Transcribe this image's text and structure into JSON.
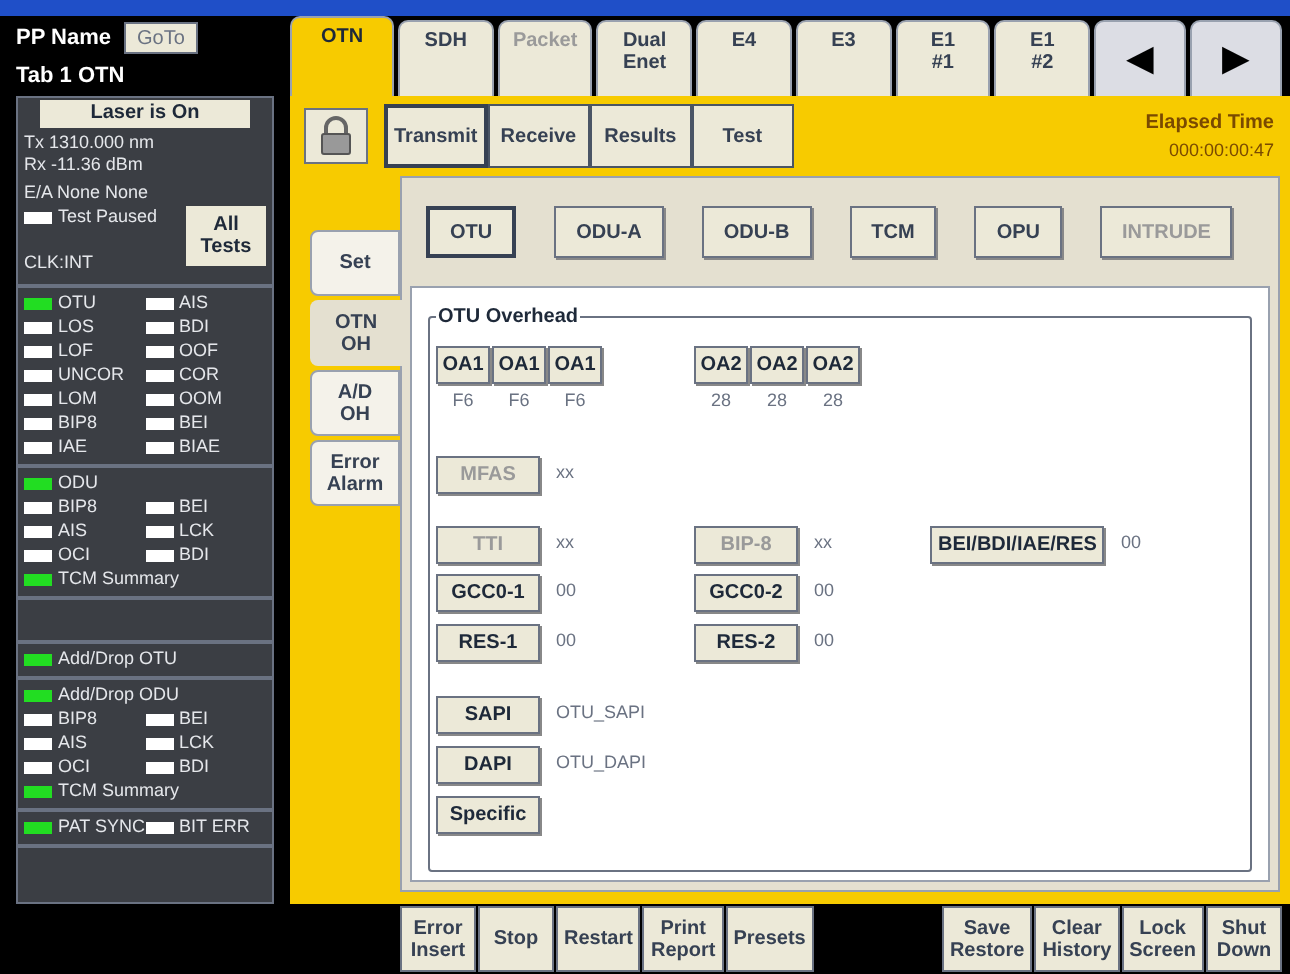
{
  "header": {
    "pp_name": "PP Name",
    "goto_button": "GoTo",
    "tab_label": "Tab 1 OTN"
  },
  "status_panel": {
    "laser_button": "Laser is On",
    "tx": "Tx 1310.000 nm",
    "rx": "Rx -11.36 dBm",
    "ea": "E/A None None",
    "test_paused": {
      "label": "Test Paused",
      "on": false
    },
    "clock": "CLK:INT",
    "all_tests_button": "All Tests"
  },
  "alarm_groups": [
    {
      "rows": [
        [
          {
            "label": "OTU",
            "on": true
          },
          {
            "label": "AIS",
            "on": false
          }
        ],
        [
          {
            "label": "LOS",
            "on": false
          },
          {
            "label": "BDI",
            "on": false
          }
        ],
        [
          {
            "label": "LOF",
            "on": false
          },
          {
            "label": "OOF",
            "on": false
          }
        ],
        [
          {
            "label": "UNCOR",
            "on": false
          },
          {
            "label": "COR",
            "on": false
          }
        ],
        [
          {
            "label": "LOM",
            "on": false
          },
          {
            "label": "OOM",
            "on": false
          }
        ],
        [
          {
            "label": "BIP8",
            "on": false
          },
          {
            "label": "BEI",
            "on": false
          }
        ],
        [
          {
            "label": "IAE",
            "on": false
          },
          {
            "label": "BIAE",
            "on": false
          }
        ]
      ]
    },
    {
      "rows": [
        [
          {
            "label": "ODU",
            "on": true
          }
        ],
        [
          {
            "label": "BIP8",
            "on": false
          },
          {
            "label": "BEI",
            "on": false
          }
        ],
        [
          {
            "label": "AIS",
            "on": false
          },
          {
            "label": "LCK",
            "on": false
          }
        ],
        [
          {
            "label": "OCI",
            "on": false
          },
          {
            "label": "BDI",
            "on": false
          }
        ],
        [
          {
            "label": "TCM Summary",
            "on": true
          }
        ]
      ]
    },
    {
      "kind": "empty"
    },
    {
      "rows": [
        [
          {
            "label": "Add/Drop OTU",
            "on": true
          }
        ]
      ]
    },
    {
      "rows": [
        [
          {
            "label": "Add/Drop ODU",
            "on": true
          }
        ],
        [
          {
            "label": "BIP8",
            "on": false
          },
          {
            "label": "BEI",
            "on": false
          }
        ],
        [
          {
            "label": "AIS",
            "on": false
          },
          {
            "label": "LCK",
            "on": false
          }
        ],
        [
          {
            "label": "OCI",
            "on": false
          },
          {
            "label": "BDI",
            "on": false
          }
        ],
        [
          {
            "label": "TCM Summary",
            "on": true
          }
        ]
      ]
    },
    {
      "rows": [
        [
          {
            "label": "PAT SYNC",
            "on": true
          },
          {
            "label": "BIT ERR",
            "on": false
          }
        ]
      ]
    }
  ],
  "tabs": [
    {
      "label": "OTN",
      "selected": true,
      "disabled": false
    },
    {
      "label": "SDH",
      "selected": false,
      "disabled": false
    },
    {
      "label": "Packet",
      "selected": false,
      "disabled": true
    },
    {
      "label": "Dual\nEnet",
      "selected": false,
      "disabled": false
    },
    {
      "label": "E4",
      "selected": false,
      "disabled": false
    },
    {
      "label": "E3",
      "selected": false,
      "disabled": false
    },
    {
      "label": "E1\n#1",
      "selected": false,
      "disabled": false
    },
    {
      "label": "E1\n#2",
      "selected": false,
      "disabled": false
    }
  ],
  "tab_scroll": [
    "◀",
    "▶"
  ],
  "sub_tabs": [
    {
      "label": "Transmit",
      "selected": true
    },
    {
      "label": "Receive",
      "selected": false
    },
    {
      "label": "Results",
      "selected": false
    },
    {
      "label": "Test",
      "selected": false
    }
  ],
  "elapsed": {
    "label": "Elapsed Time",
    "value": "000:00:00:47"
  },
  "side_tabs": [
    {
      "label": "Set",
      "selected": false
    },
    {
      "label": "OTN\nOH",
      "selected": true
    },
    {
      "label": "A/D\nOH",
      "selected": false
    },
    {
      "label": "Error\nAlarm",
      "selected": false
    }
  ],
  "layer_buttons": [
    {
      "label": "OTU",
      "selected": true,
      "disabled": false
    },
    {
      "label": "ODU-A",
      "selected": false,
      "disabled": false
    },
    {
      "label": "ODU-B",
      "selected": false,
      "disabled": false
    },
    {
      "label": "TCM",
      "selected": false,
      "disabled": false
    },
    {
      "label": "OPU",
      "selected": false,
      "disabled": false
    },
    {
      "label": "INTRUDE",
      "selected": false,
      "disabled": true
    }
  ],
  "overhead": {
    "title": "OTU Overhead",
    "rows": [
      {
        "kind": "bytes",
        "groups": [
          [
            {
              "label": "OA1",
              "value": "F6"
            },
            {
              "label": "OA1",
              "value": "F6"
            },
            {
              "label": "OA1",
              "value": "F6"
            }
          ],
          [
            {
              "label": "OA2",
              "value": "28"
            },
            {
              "label": "OA2",
              "value": "28"
            },
            {
              "label": "OA2",
              "value": "28"
            }
          ]
        ]
      },
      {
        "kind": "fields",
        "fields": [
          {
            "label": "MFAS",
            "value": "xx",
            "disabled": true
          }
        ]
      },
      {
        "kind": "fields",
        "fields": [
          {
            "label": "TTI",
            "value": "xx",
            "disabled": true
          },
          {
            "label": "BIP-8",
            "value": "xx",
            "disabled": true
          },
          {
            "label": "BEI/BDI/IAE/RES",
            "value": "00",
            "disabled": false
          }
        ]
      },
      {
        "kind": "fields",
        "fields": [
          {
            "label": "GCC0-1",
            "value": "00",
            "disabled": false
          },
          {
            "label": "GCC0-2",
            "value": "00",
            "disabled": false
          }
        ]
      },
      {
        "kind": "fields",
        "fields": [
          {
            "label": "RES-1",
            "value": "00",
            "disabled": false
          },
          {
            "label": "RES-2",
            "value": "00",
            "disabled": false
          }
        ]
      },
      {
        "kind": "fields",
        "fields": [
          {
            "label": "SAPI",
            "value": "OTU_SAPI",
            "disabled": false
          }
        ]
      },
      {
        "kind": "fields",
        "fields": [
          {
            "label": "DAPI",
            "value": "OTU_DAPI",
            "disabled": false
          }
        ]
      },
      {
        "kind": "fields",
        "fields": [
          {
            "label": "Specific",
            "disabled": false
          }
        ]
      }
    ]
  },
  "bottom_buttons": {
    "left": [
      "Error\nInsert",
      "Stop",
      "Restart",
      "Print\nReport",
      "Presets"
    ],
    "right": [
      "Save\nRestore",
      "Clear\nHistory",
      "Lock\nScreen",
      "Shut\nDown"
    ]
  }
}
